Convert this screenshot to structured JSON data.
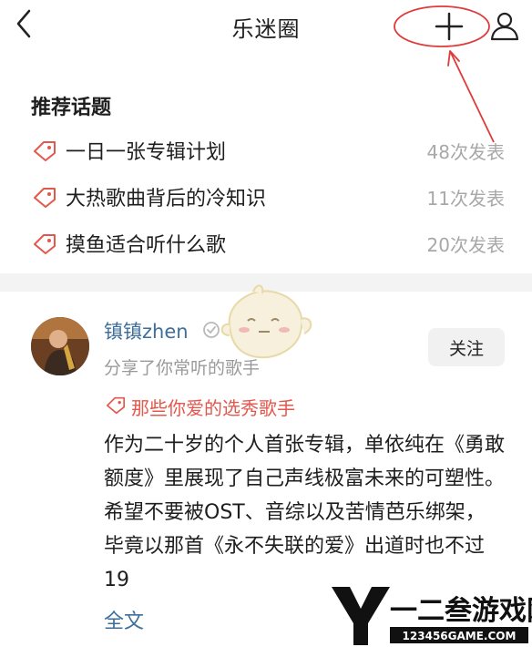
{
  "header": {
    "title": "乐迷圈",
    "icons": {
      "back": "chevron-left-icon",
      "add": "plus-icon",
      "profile": "user-icon"
    }
  },
  "topics": {
    "title": "推荐话题",
    "items": [
      {
        "label": "一日一张专辑计划",
        "count": "48次发表"
      },
      {
        "label": "大热歌曲背后的冷知识",
        "count": "11次发表"
      },
      {
        "label": "摸鱼适合听什么歌",
        "count": "20次发表"
      }
    ]
  },
  "post": {
    "username": "镇镇zhen",
    "subtitle": "分享了你常听的歌手",
    "follow_label": "关注",
    "tag": "那些你爱的选秀歌手",
    "body": "作为二十岁的个人首张专辑，单依纯在《勇敢额度》里展现了自己声线极富未来的可塑性。希望不要被OST、音综以及苦情芭乐绑架，毕竟以那首《永不失联的爱》出道时也不过19",
    "read_more": "全文"
  },
  "watermark": {
    "brand": "一二叁游戏网",
    "url": "123456GAME.COM"
  },
  "colors": {
    "accent_red": "#e4574c",
    "link_blue": "#3e6f9a",
    "muted": "#a8a8a8",
    "annotation": "#e03a3a"
  }
}
